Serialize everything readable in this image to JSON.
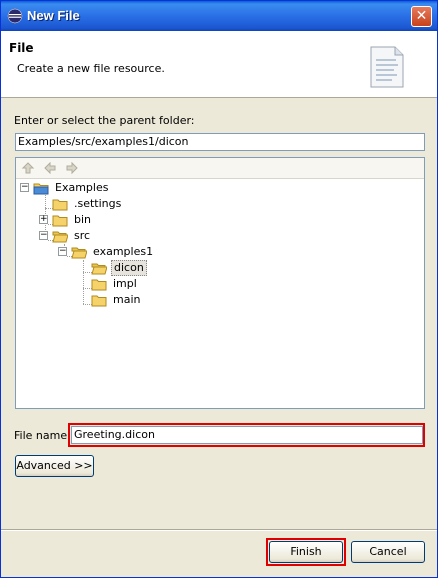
{
  "window": {
    "title": "New File"
  },
  "header": {
    "title": "File",
    "description": "Create a new file resource."
  },
  "parent_folder": {
    "label": "Enter or select the parent folder:",
    "value": "Examples/src/examples1/dicon"
  },
  "tree": {
    "nodes": [
      {
        "label": "Examples",
        "expander": "−"
      },
      {
        "label": ".settings",
        "expander": ""
      },
      {
        "label": "bin",
        "expander": "+"
      },
      {
        "label": "src",
        "expander": "−"
      },
      {
        "label": "examples1",
        "expander": "−"
      },
      {
        "label": "dicon",
        "expander": ""
      },
      {
        "label": "impl",
        "expander": ""
      },
      {
        "label": "main",
        "expander": ""
      }
    ]
  },
  "file_name": {
    "label": "File name:",
    "value": "Greeting.dicon"
  },
  "buttons": {
    "advanced": "Advanced >>",
    "finish": "Finish",
    "cancel": "Cancel"
  },
  "colors": {
    "highlight_outline": "#e00000",
    "title_bar": "#2a6fe6"
  }
}
